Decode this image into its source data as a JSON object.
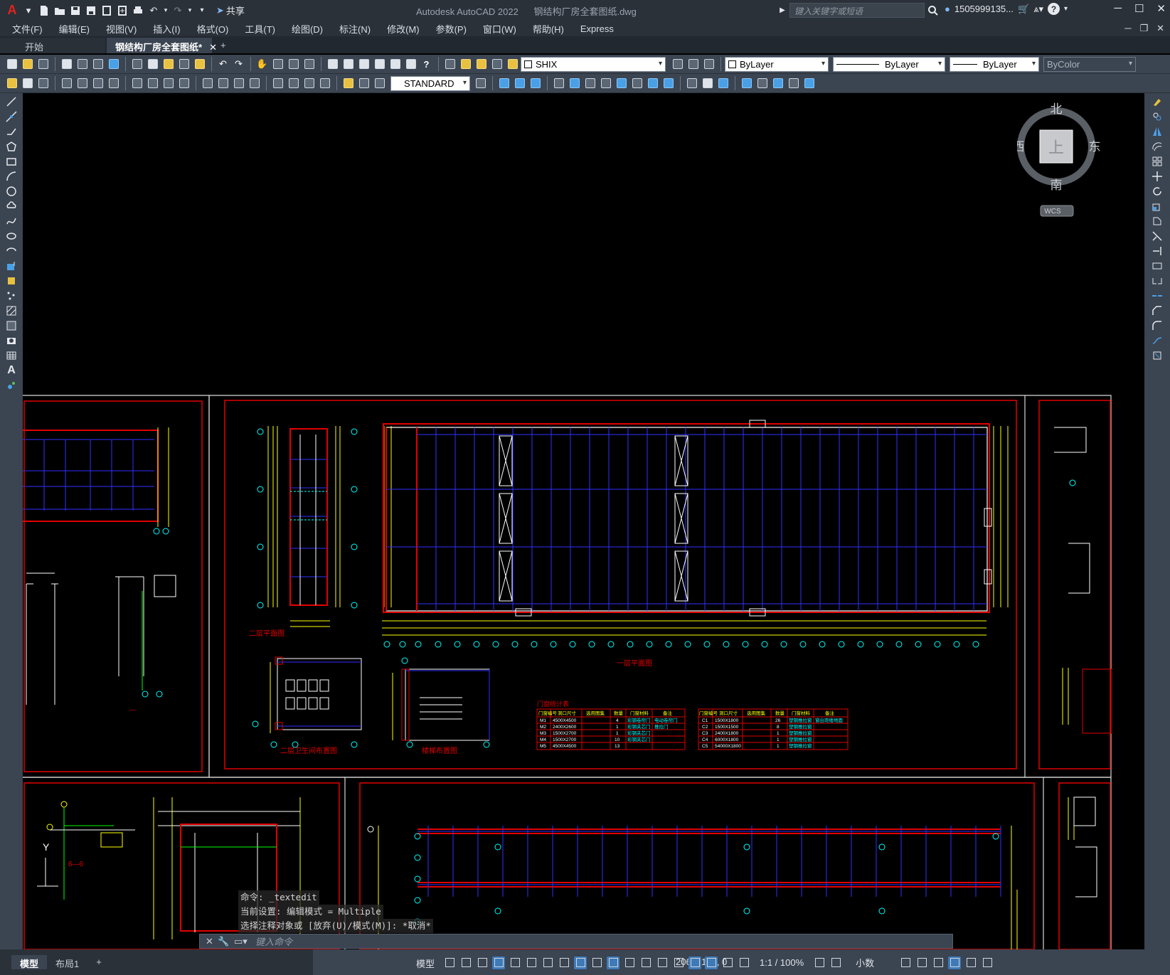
{
  "titlebar": {
    "share_label": "共享",
    "app_title": "Autodesk AutoCAD 2022",
    "file_title": "钢结构厂房全套图纸.dwg",
    "search_placeholder": "键入关键字或短语",
    "user": "1505999135..."
  },
  "menu": [
    "文件(F)",
    "编辑(E)",
    "视图(V)",
    "插入(I)",
    "格式(O)",
    "工具(T)",
    "绘图(D)",
    "标注(N)",
    "修改(M)",
    "参数(P)",
    "窗口(W)",
    "帮助(H)",
    "Express"
  ],
  "tabs": {
    "start": "开始",
    "active": "钢结构厂房全套图纸*",
    "plus": "+"
  },
  "properties": {
    "layer": "SHIX",
    "color": "ByLayer",
    "linetype": "ByLayer",
    "lineweight": "ByLayer",
    "plotstyle": "ByColor",
    "textstyle": "STANDARD"
  },
  "viewcube": {
    "north": "北",
    "south": "南",
    "east": "东",
    "west": "西",
    "face": "上",
    "wcs": "WCS"
  },
  "drawing": {
    "labels": {
      "floor2_plan": "二层平面图",
      "floor1_plan": "一层平面图",
      "floor2_toilet": "二层卫生间布置图",
      "stair": "楼梯布置图",
      "door_table_title": "门窗统计表",
      "section_66": "6—6",
      "axis_y": "Y"
    },
    "door_table": {
      "headers": [
        "门窗编号",
        "洞口尺寸",
        "选用图集",
        "数量",
        "门窗材料",
        "备注"
      ],
      "rows": [
        [
          "M1",
          "4500X4500",
          "",
          "4",
          "彩钢卷帘门",
          "电动卷帘门"
        ],
        [
          "M2",
          "2400X2600",
          "",
          "1",
          "彩钢夹芯门",
          "推拉门"
        ],
        [
          "M3",
          "1500X2700",
          "",
          "1",
          "彩钢夹芯门",
          ""
        ],
        [
          "M4",
          "1500X2700",
          "",
          "10",
          "彩钢夹芯门",
          ""
        ],
        [
          "M5",
          "4500X4500",
          "",
          "13",
          "",
          ""
        ]
      ]
    },
    "window_table": {
      "headers": [
        "门窗编号",
        "洞口尺寸",
        "选用图集",
        "数量",
        "门窗材料",
        "备注"
      ],
      "rows": [
        [
          "C1",
          "1500X1800",
          "",
          "26",
          "塑钢推拉窗",
          "窗台距楼地面"
        ],
        [
          "C2",
          "1500X1500",
          "",
          "8",
          "塑钢推拉窗",
          ""
        ],
        [
          "C3",
          "2400X1800",
          "",
          "1",
          "塑钢推拉窗",
          ""
        ],
        [
          "C4",
          "6000X1800",
          "",
          "1",
          "塑钢推拉窗",
          ""
        ],
        [
          "C5",
          "54000X1800",
          "",
          "1",
          "塑钢推拉窗",
          ""
        ]
      ]
    }
  },
  "command": {
    "history": [
      "命令: _textedit",
      "当前设置: 编辑模式 = Multiple",
      "选择注释对象或 [放弃(U)/模式(M)]: *取消*"
    ],
    "placeholder": "键入命令"
  },
  "status": {
    "model_tab": "模型",
    "layout_tab": "布局1",
    "add_tab": "+",
    "coords": "2068, 109, 0",
    "space": "模型",
    "scale": "1:1 / 100%",
    "units": "小数"
  }
}
